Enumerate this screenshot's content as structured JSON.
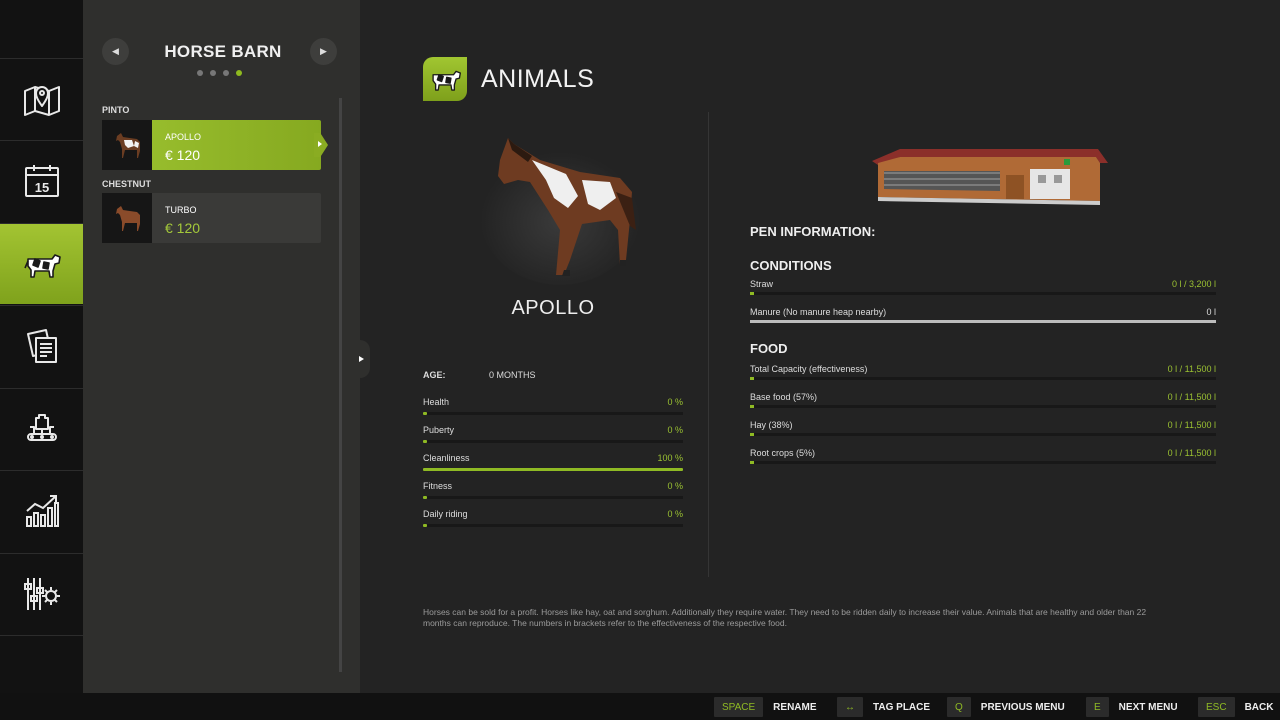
{
  "nav": {
    "items": [
      {
        "icon": "map-pin-icon"
      },
      {
        "icon": "calendar-icon",
        "day": "15"
      },
      {
        "icon": "cow-icon"
      },
      {
        "icon": "documents-icon"
      },
      {
        "icon": "production-icon"
      },
      {
        "icon": "bar-chart-icon"
      },
      {
        "icon": "settings-sliders-icon"
      }
    ],
    "active_index": 2
  },
  "panel": {
    "title": "HORSE BARN",
    "page_dots": 4,
    "active_dot": 3,
    "groups": [
      {
        "label": "PINTO",
        "animals": [
          {
            "name": "APOLLO",
            "price": "€ 120",
            "selected": true
          }
        ]
      },
      {
        "label": "CHESTNUT",
        "animals": [
          {
            "name": "TURBO",
            "price": "€ 120",
            "selected": false
          }
        ]
      }
    ]
  },
  "page": {
    "title": "ANIMALS"
  },
  "animal": {
    "name": "APOLLO",
    "age_label": "AGE:",
    "age_value": "0 MONTHS",
    "stats": [
      {
        "label": "Health",
        "value": "0 %",
        "fill": 0
      },
      {
        "label": "Puberty",
        "value": "0 %",
        "fill": 0
      },
      {
        "label": "Cleanliness",
        "value": "100 %",
        "fill": 1
      },
      {
        "label": "Fitness",
        "value": "0 %",
        "fill": 0
      },
      {
        "label": "Daily riding",
        "value": "0 %",
        "fill": 0
      }
    ]
  },
  "pen": {
    "title": "PEN INFORMATION:",
    "conditions_title": "CONDITIONS",
    "conditions": [
      {
        "label": "Straw",
        "value": "0 l / 3,200 l",
        "fill": 0
      },
      {
        "label": "Manure (No manure heap nearby)",
        "value": "0 l",
        "fill": 1
      }
    ],
    "food_title": "FOOD",
    "food": [
      {
        "label": "Total Capacity (effectiveness)",
        "value": "0 l / 11,500 l",
        "fill": 0
      },
      {
        "label": "Base food (57%)",
        "value": "0 l / 11,500 l",
        "fill": 0
      },
      {
        "label": "Hay (38%)",
        "value": "0 l / 11,500 l",
        "fill": 0
      },
      {
        "label": "Root crops (5%)",
        "value": "0 l / 11,500 l",
        "fill": 0
      }
    ]
  },
  "description": "Horses can be sold for a profit. Horses like hay, oat and sorghum. Additionally they require water. They need to be ridden daily to increase their value. Animals that are healthy and older than 22 months can reproduce. The numbers in brackets refer to the effectiveness of the respective food.",
  "hints": [
    {
      "key": "SPACE",
      "label": "RENAME"
    },
    {
      "key": "↔",
      "label": "TAG PLACE"
    },
    {
      "key": "Q",
      "label": "PREVIOUS MENU"
    },
    {
      "key": "E",
      "label": "NEXT MENU"
    },
    {
      "key": "ESC",
      "label": "BACK"
    }
  ],
  "colors": {
    "accent": "#8fba24",
    "accent_light": "#a3c432",
    "panel": "#2f2f2d",
    "background": "#232323",
    "nav": "#121212"
  }
}
